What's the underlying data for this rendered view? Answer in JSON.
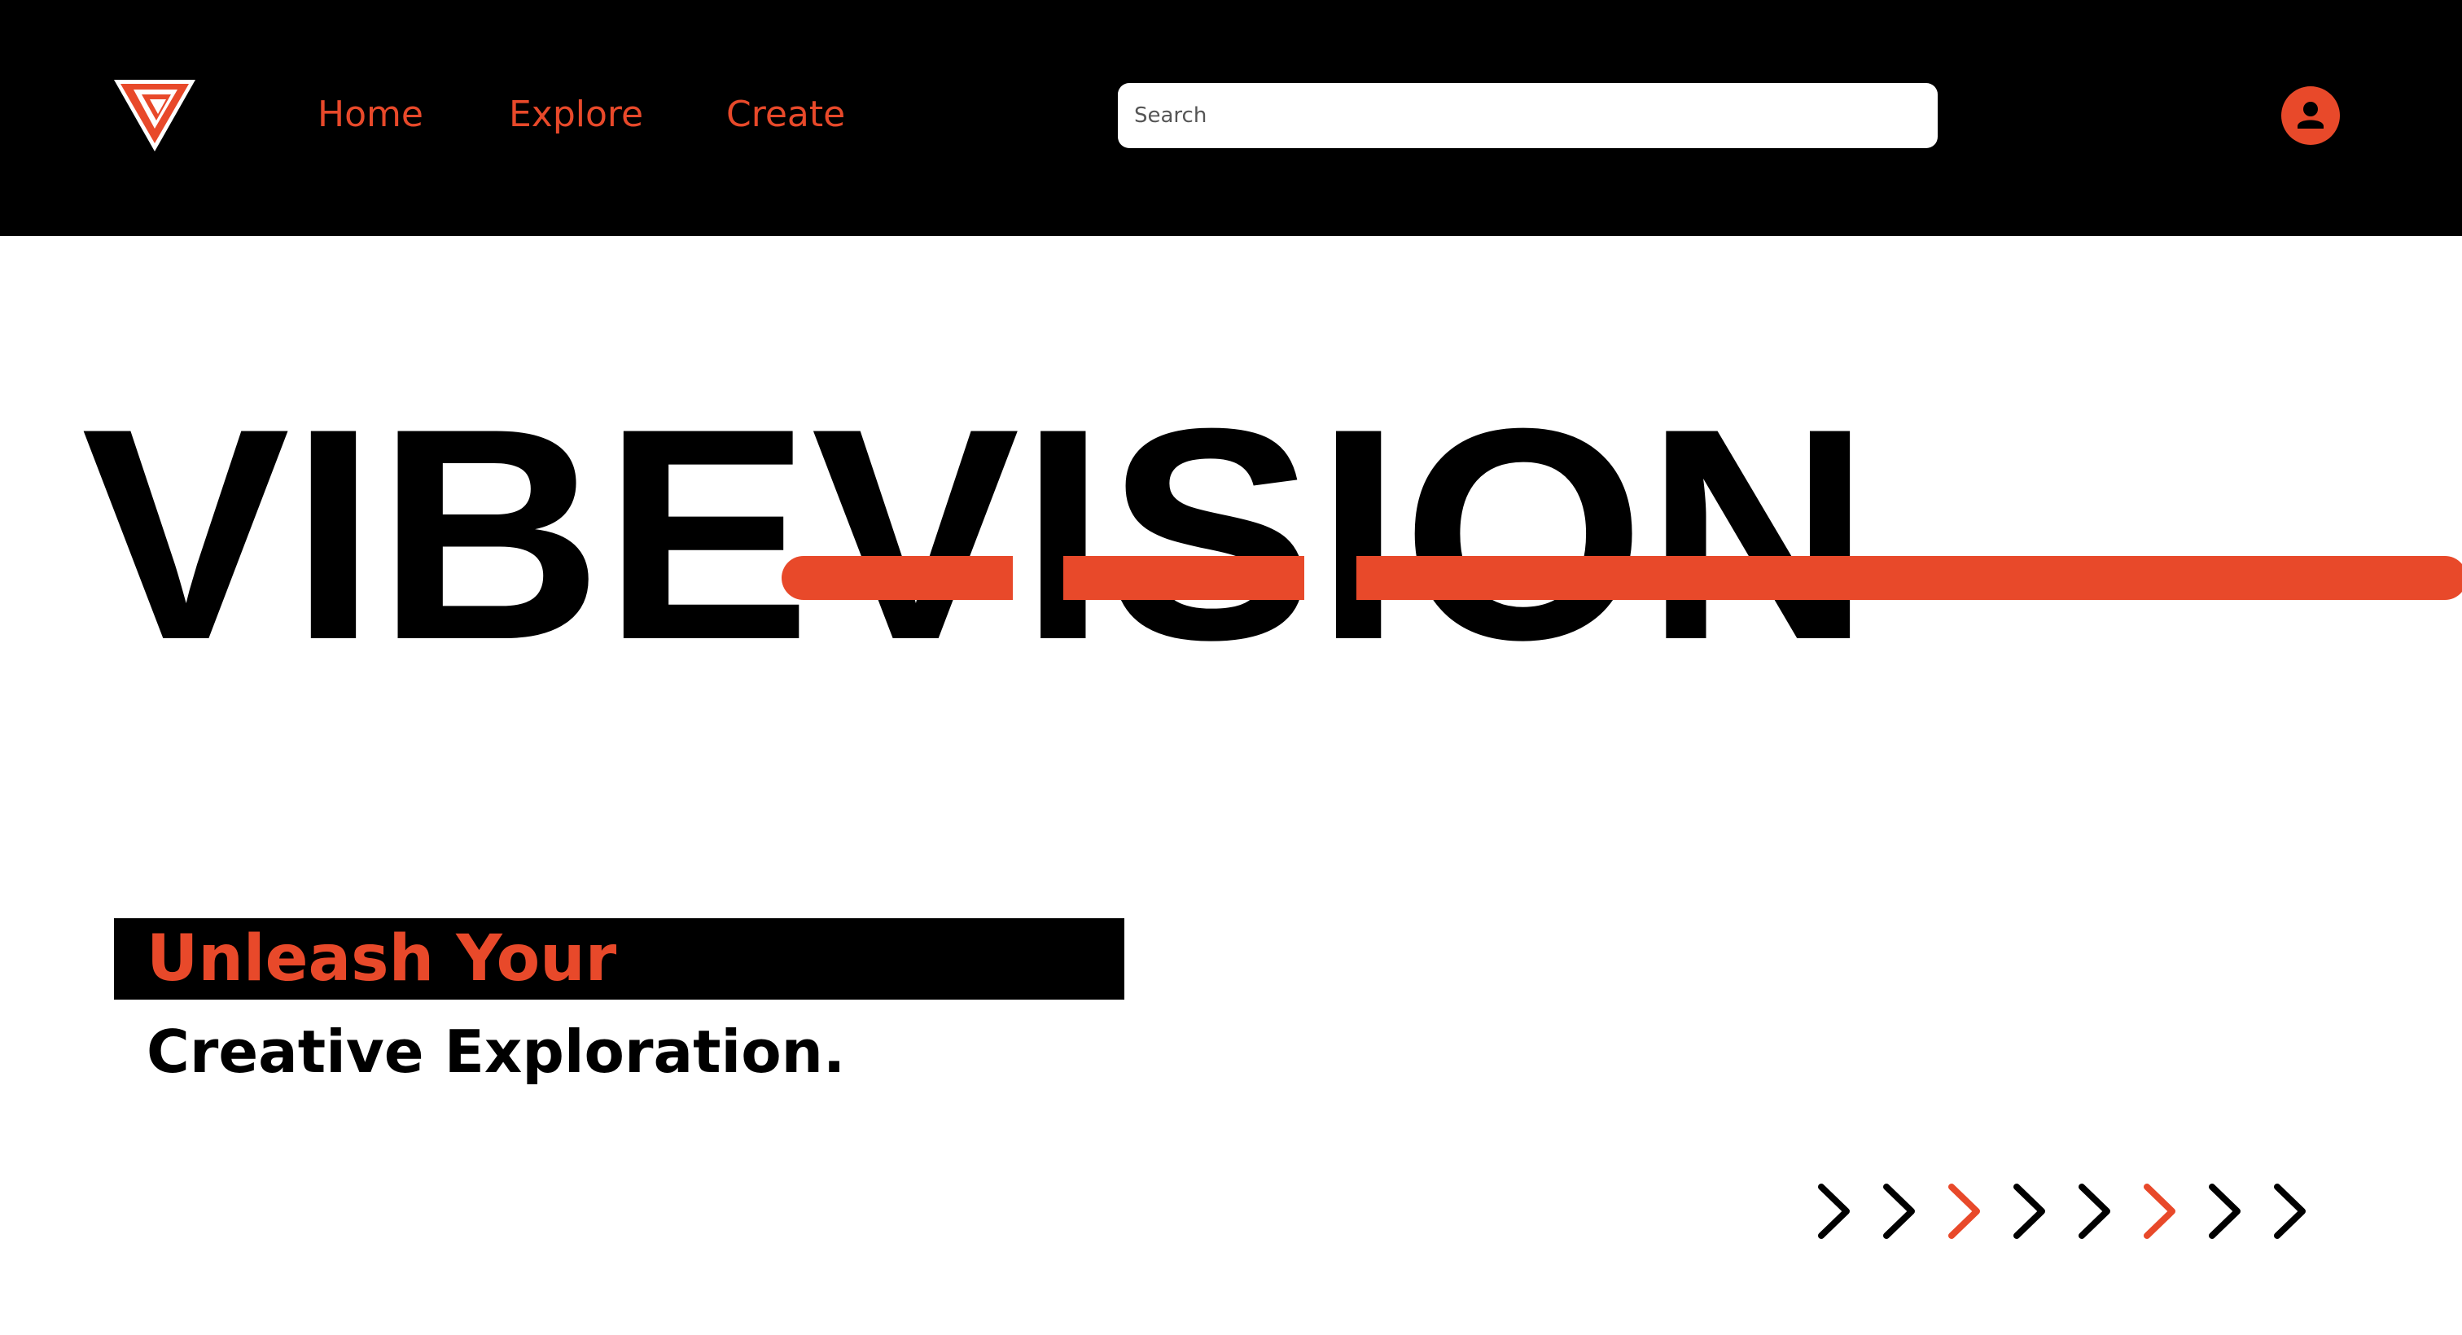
{
  "brand": {
    "name": "VIBEVISION",
    "logo_icon": "triangle-v-logo-icon",
    "accent_color": "#e8492a",
    "dark_color": "#000000",
    "background_color": "#ffffff"
  },
  "nav": {
    "items": [
      {
        "label": "Home"
      },
      {
        "label": "Explore"
      },
      {
        "label": "Create"
      }
    ]
  },
  "search": {
    "placeholder": "Search",
    "value": ""
  },
  "user": {
    "icon": "user-avatar-icon"
  },
  "hero": {
    "wordmark": "VIBEVISION",
    "tagline_line1": "Unleash Your",
    "tagline_line2": "Creative Exploration."
  },
  "chevrons": {
    "icon": "chevron-right-icon",
    "count": 8,
    "colors": [
      "#000000",
      "#000000",
      "#e8492a",
      "#000000",
      "#000000",
      "#e8492a",
      "#000000",
      "#000000"
    ]
  }
}
